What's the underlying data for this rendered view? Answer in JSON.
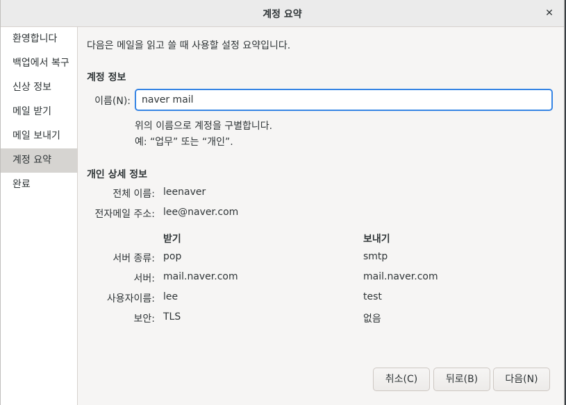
{
  "window": {
    "title": "계정 요약",
    "close_glyph": "✕"
  },
  "sidebar": {
    "items": [
      {
        "label": "환영합니다"
      },
      {
        "label": "백업에서 복구"
      },
      {
        "label": "신상 정보"
      },
      {
        "label": "메일 받기"
      },
      {
        "label": "메일 보내기"
      },
      {
        "label": "계정 요약"
      },
      {
        "label": "완료"
      }
    ],
    "active_index": 5
  },
  "main": {
    "intro": "다음은 메일을 읽고 쓸 때 사용할 설정 요약입니다.",
    "account_section": {
      "heading": "계정 정보",
      "name_label": "이름(N):",
      "name_value": "naver mail",
      "hint_line1": "위의 이름으로 계정을 구별합니다.",
      "hint_line2": "예: “업무” 또는 “개인”."
    },
    "personal_section": {
      "heading": "개인 상세 정보",
      "full_name_label": "전체 이름:",
      "full_name_value": "leenaver",
      "email_label": "전자메일 주소:",
      "email_value": "lee@naver.com"
    },
    "servers": {
      "receive_heading": "받기",
      "send_heading": "보내기",
      "rows": [
        {
          "label": "서버 종류:",
          "receive": "pop",
          "send": "smtp"
        },
        {
          "label": "서버:",
          "receive": "mail.naver.com",
          "send": "mail.naver.com"
        },
        {
          "label": "사용자이름:",
          "receive": "lee",
          "send": "test"
        },
        {
          "label": "보안:",
          "receive": "TLS",
          "send": "없음"
        }
      ]
    }
  },
  "buttons": {
    "cancel": "취소(C)",
    "back": "뒤로(B)",
    "next": "다음(N)"
  },
  "colors": {
    "accent": "#3584e4",
    "sidebar_active": "#d6d4d1"
  }
}
